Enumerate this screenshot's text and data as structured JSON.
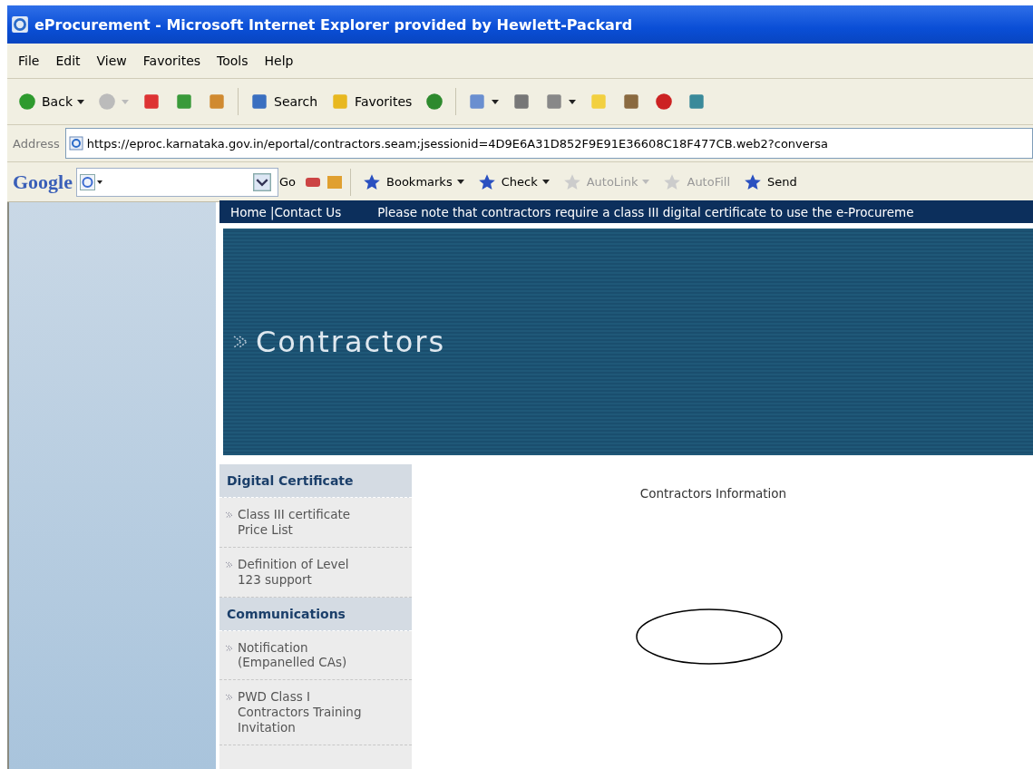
{
  "window": {
    "title": "eProcurement - Microsoft Internet Explorer provided by Hewlett-Packard"
  },
  "menu": [
    "File",
    "Edit",
    "View",
    "Favorites",
    "Tools",
    "Help"
  ],
  "toolbar": [
    {
      "label": "Back",
      "dropdown": true,
      "disabled": false
    },
    {
      "dropdown": true,
      "disabled": true
    },
    {
      "dropdown": false,
      "disabled": false
    },
    {
      "dropdown": false,
      "disabled": false
    },
    {
      "dropdown": false,
      "disabled": false
    },
    {
      "label": "Search",
      "dropdown": false,
      "disabled": false
    },
    {
      "label": "Favorites",
      "dropdown": false,
      "disabled": false
    },
    {
      "dropdown": false,
      "disabled": false
    },
    {
      "dropdown": true,
      "disabled": false
    },
    {
      "dropdown": false,
      "disabled": false
    },
    {
      "dropdown": true,
      "disabled": false
    },
    {
      "dropdown": false,
      "disabled": false
    },
    {
      "dropdown": false,
      "disabled": false
    },
    {
      "dropdown": false,
      "disabled": false
    },
    {
      "dropdown": false,
      "disabled": false
    }
  ],
  "address": {
    "label": "Address",
    "url": "https://eproc.karnataka.gov.in/eportal/contractors.seam;jsessionid=4D9E6A31D852F9E91E36608C18F477CB.web2?conversa"
  },
  "google_bar": {
    "logo": "Google",
    "go": "Go",
    "items": [
      {
        "label": "Bookmarks",
        "dropdown": true,
        "disabled": false
      },
      {
        "label": "Check",
        "dropdown": true,
        "disabled": false
      },
      {
        "label": "AutoLink",
        "dropdown": true,
        "disabled": true
      },
      {
        "label": "AutoFill",
        "dropdown": false,
        "disabled": true
      },
      {
        "label": "Send",
        "dropdown": false,
        "disabled": false
      }
    ]
  },
  "nav": {
    "links": [
      "Home",
      "Contact Us"
    ],
    "separator": "|",
    "notice": "Please note that contractors require a class III digital certificate to use the e-Procureme"
  },
  "banner": {
    "title": "Contractors"
  },
  "sidebar": [
    {
      "heading": "Digital Certificate",
      "items": [
        "Class III certificate Price List",
        "Definition of Level 123 support"
      ]
    },
    {
      "heading": "Communications",
      "items": [
        "Notification (Empanelled CAs)",
        "PWD Class I Contractors Training Invitation"
      ]
    }
  ],
  "content": {
    "title": "Contractors Information"
  }
}
